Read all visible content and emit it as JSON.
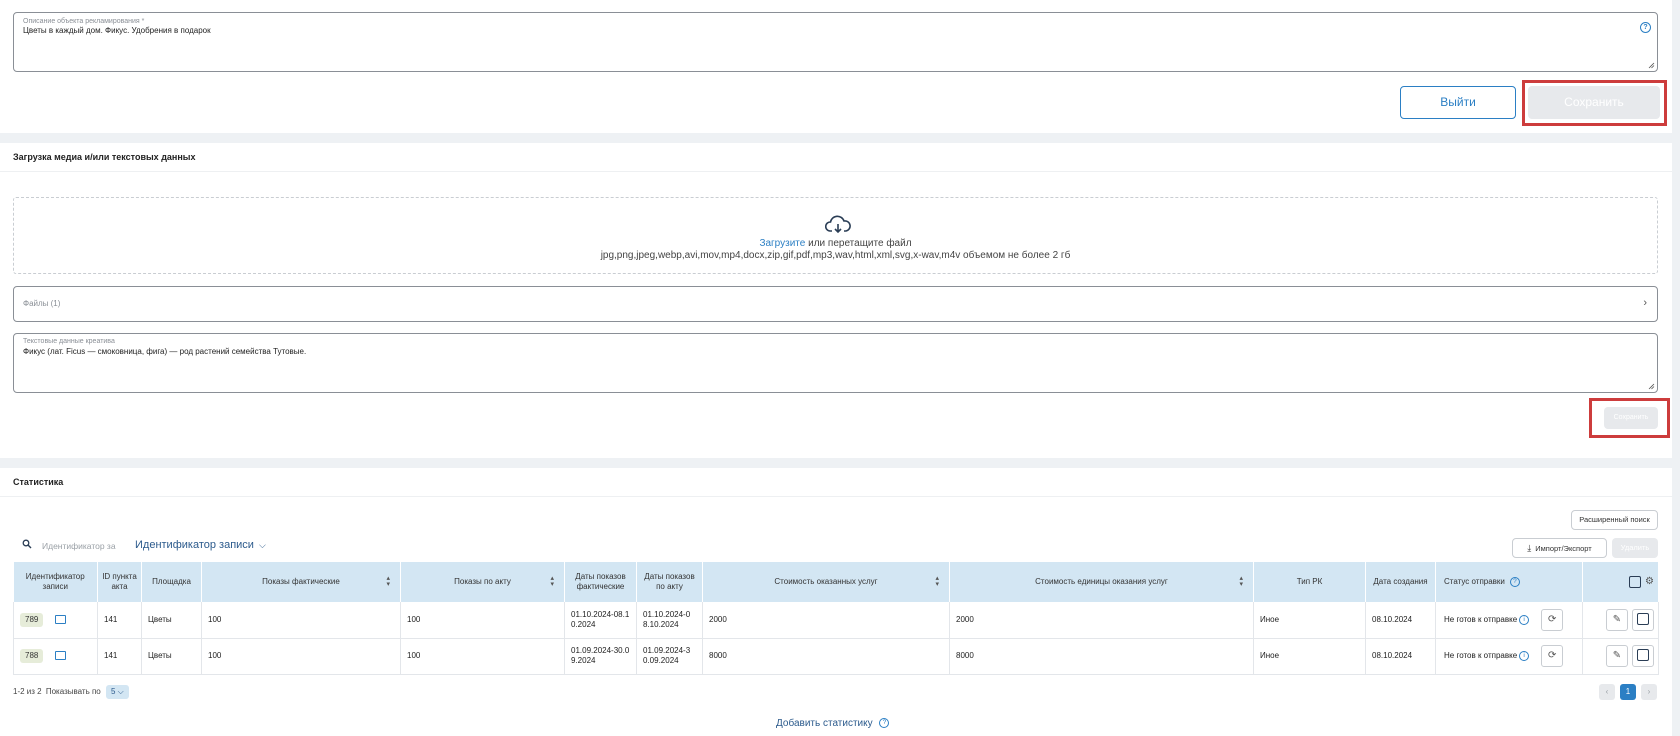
{
  "object_description": {
    "label": "Описание объекта рекламирования *",
    "value": "Цветы в каждый дом. Фикус. Удобрения в подарок"
  },
  "actions_top": {
    "exit_label": "Выйти",
    "save_label": "Сохранить"
  },
  "media_section": {
    "title": "Загрузка медиа и/или текстовых данных",
    "upload_link": "Загрузите",
    "upload_text": " или перетащите файл",
    "formats": "jpg,png,jpeg,webp,avi,mov,mp4,docx,zip,gif,pdf,mp3,wav,html,xml,svg,x-wav,m4v объемом не более 2 гб",
    "files_label": "Файлы (1)",
    "creative_text_label": "Текстовые данные креатива",
    "creative_text_value": "Фикус (лат. Ficus — смоковница, фига) — род растений семейства Тутовые.",
    "save_label": "Сохранить"
  },
  "stats": {
    "title": "Статистика",
    "advanced_search_label": "Расширенный поиск",
    "import_export_label": "Импорт/Экспорт",
    "delete_label": "Удалить",
    "search_placeholder": "Идентификатор за",
    "search_field_select": "Идентификатор записи",
    "columns": [
      "Идентификатор записи",
      "ID пункта акта",
      "Площадка",
      "Показы фактические",
      "Показы по акту",
      "Даты показов фактические",
      "Даты показов по акту",
      "Стоимость оказанных услуг",
      "Стоимость единицы оказания услуг",
      "Тип РК",
      "Дата создания",
      "Статус отправки"
    ],
    "rows": [
      {
        "id": "789",
        "act_item": "141",
        "platform": "Цветы",
        "shows_fact": "100",
        "shows_act": "100",
        "dates_fact": "01.10.2024-08.10.2024",
        "dates_act": "01.10.2024-08.10.2024",
        "cost": "2000",
        "unit_cost": "2000",
        "rk_type": "Иное",
        "created": "08.10.2024",
        "status": "Не готов к отправке"
      },
      {
        "id": "788",
        "act_item": "141",
        "platform": "Цветы",
        "shows_fact": "100",
        "shows_act": "100",
        "dates_fact": "01.09.2024-30.09.2024",
        "dates_act": "01.09.2024-30.09.2024",
        "cost": "8000",
        "unit_cost": "8000",
        "rk_type": "Иное",
        "created": "08.10.2024",
        "status": "Не готов к отправке"
      }
    ],
    "range_text": "1-2 из 2",
    "per_page_label": "Показывать по",
    "per_page_value": "5",
    "current_page": "1",
    "add_stat_label": "Добавить статистику"
  },
  "colors": {
    "accent": "#2b7fc4",
    "highlight": "#cd3c3c",
    "header_bg": "#d3e6f3"
  }
}
